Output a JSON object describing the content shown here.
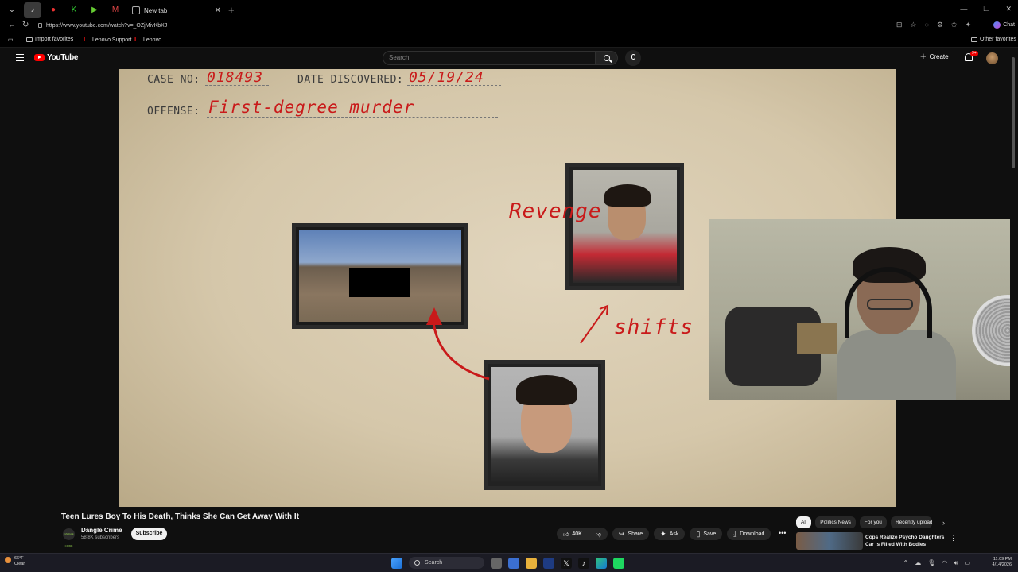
{
  "browser": {
    "tab_title": "New tab",
    "url": "https://www.youtube.com/watch?v=_OZjMivKbXJ",
    "chat_label": "Chat",
    "favorites": [
      {
        "label": "Import favorites"
      },
      {
        "label": "Lenovo Support"
      },
      {
        "label": "Lenovo"
      }
    ],
    "other_favorites": "Other favorites"
  },
  "youtube": {
    "logo_text": "YouTube",
    "search_placeholder": "Search",
    "create_label": "Create",
    "notification_count": "9+"
  },
  "video_frame": {
    "case_no_label": "CASE NO:",
    "case_no_value": "018493",
    "date_label": "DATE DISCOVERED:",
    "date_value": "05/19/24",
    "offense_label": "OFFENSE:",
    "offense_value": "First-degree murder",
    "note_revenge": "Revenge",
    "note_shifts": "shifts"
  },
  "video": {
    "title": "Teen Lures Boy To His Death, Thinks She Can Get Away With It",
    "channel_name": "Dangle Crime",
    "channel_logo_text": "DANGLE CRIME",
    "subscribers": "58.8K subscribers",
    "subscribe_label": "Subscribe",
    "like_count": "40K",
    "share_label": "Share",
    "ask_label": "Ask",
    "save_label": "Save",
    "download_label": "Download"
  },
  "sidebar": {
    "chips": [
      "All",
      "Politics News",
      "For you",
      "Recently uploaded"
    ],
    "recommendation_title": "Cops Realize Psycho Daughters Car Is Filled With Bodies"
  },
  "taskbar": {
    "weather_temp": "66°F",
    "weather_cond": "Clear",
    "search_label": "Search",
    "time": "11:09 PM",
    "date": "4/14/2026"
  }
}
